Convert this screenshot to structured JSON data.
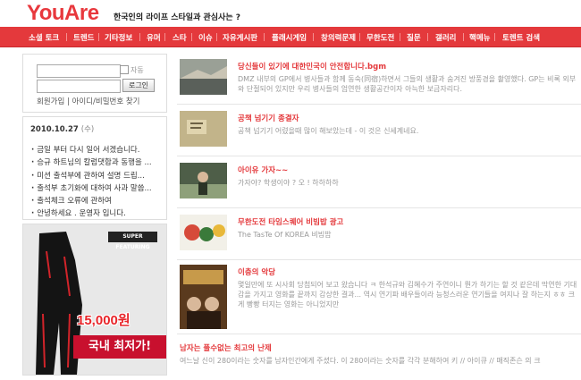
{
  "site": {
    "logo": "YouAre",
    "tagline": "한국인의 라이프 스타일과 관심사는 ?"
  },
  "nav": [
    "소셜 토크",
    "트렌드",
    "기타정보",
    "유머",
    "스타",
    "이슈",
    "자유게시판",
    "플래시게임",
    "창의력문제",
    "무한도전",
    "질문",
    "갤러리",
    "핵메뉴",
    "토렌트 검색"
  ],
  "login": {
    "id_placeholder": "",
    "pw_placeholder": "",
    "save_label": "자동",
    "button_label": "로그인",
    "links": "회원가입 | 아이디/비밀번호 찾기"
  },
  "notice": {
    "date": "2010.10.27",
    "dow": "(수)",
    "items": [
      "금일 부터 다시 일어 서겠습니다.",
      "승규 하트님의 칼럼댓합과 동행을 ...",
      "미션 출석부에 관하여 설명 드립...",
      "출석부 초기화에 대하여 사과 말씀...",
      "출석체크 오류에 관하여",
      "안녕하세요 . 운영자 입니다."
    ]
  },
  "ad": {
    "brand": "SUPER FEATURING",
    "price": "15,000원",
    "slogan": "국내 최저가!"
  },
  "posts": [
    {
      "title": "당신들이 있기에 대한민국이 안전합니다.bgm",
      "desc": "DMZ 내부의 GP에서 병사들과 함께 동숙(同宿)하면서 그들의 생활과 숨겨진 방풍경을 촬영했다. GP는 비록 외부와 단절되어 있지만 우리 병사들의 엄연한 생활공간이자 아늑한 보금자리다.",
      "thumb_colors": [
        "#8a8f86",
        "#c9c4b4",
        "#3d4440"
      ]
    },
    {
      "title": "공책 넘기기 종결자",
      "desc": "공책 넘기기 어렸을때 많이 해보았는데 - 이 것은 신세계네요.",
      "thumb_colors": [
        "#b5a47a",
        "#d8c79c",
        "#6e6245"
      ]
    },
    {
      "title": "아이유 가자~~",
      "desc": "가자야? 학생이야 ? 오 ! 하하하하",
      "thumb_colors": [
        "#4a5a4a",
        "#8ea07a",
        "#2b3326"
      ]
    },
    {
      "title": "무한도전 타임스퀘어 비빔밥 광고",
      "desc": "The TasTe Of KOREA 비빔밥",
      "thumb_colors": [
        "#f2f0e8",
        "#d64a3a",
        "#3a7a3a"
      ]
    },
    {
      "title": "이층의 악당",
      "desc": "몇일만에 또 시사회 당첨되어 보고 왔습니다 ㅋ 한석규와 김혜수가 주연이니 뭔가 하기는 할 것 같은데 막연한 기대감을 가지고 영화를 끝까지 감상한 결과... 역시 연기파 배우들이라 능청스러운 연기들을 여지나 잘 하는지 ㅎㅎ 크게 빵빵 터지는 영화는 아니었지만",
      "thumb_colors": [
        "#6a4a2a",
        "#c79a4a",
        "#2a1a10"
      ]
    },
    {
      "title": "남자는 풀수없는 최고의 난제",
      "desc": "여느날 신이 280이라는 숫자를 남자인간에게 주셨다. 이 280이라는 숫자를 각각 분해하여 키 // 아이큐 // 매직존슨 의 크",
      "thumb_colors": []
    }
  ]
}
